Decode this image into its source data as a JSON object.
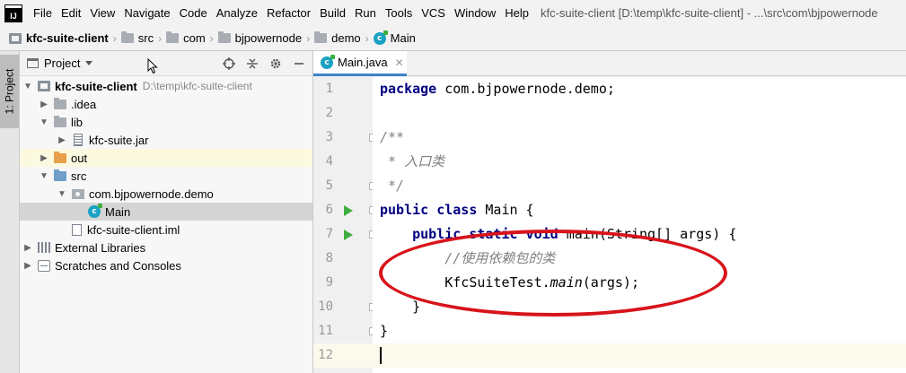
{
  "menubar": {
    "logo": "IJ",
    "items": [
      "File",
      "Edit",
      "View",
      "Navigate",
      "Code",
      "Analyze",
      "Refactor",
      "Build",
      "Run",
      "Tools",
      "VCS",
      "Window",
      "Help"
    ],
    "window_title": "kfc-suite-client [D:\\temp\\kfc-suite-client] - ...\\src\\com\\bjpowernode"
  },
  "breadcrumb": {
    "items": [
      "kfc-suite-client",
      "src",
      "com",
      "bjpowernode",
      "demo",
      "Main"
    ],
    "separator": "›"
  },
  "tool_strip": {
    "project_tab": "1: Project"
  },
  "project_panel": {
    "title": "Project",
    "tree": [
      {
        "label": "kfc-suite-client",
        "hint": "D:\\temp\\kfc-suite-client"
      },
      {
        "label": ".idea"
      },
      {
        "label": "lib"
      },
      {
        "label": "kfc-suite.jar"
      },
      {
        "label": "out"
      },
      {
        "label": "src"
      },
      {
        "label": "com.bjpowernode.demo"
      },
      {
        "label": "Main"
      },
      {
        "label": "kfc-suite-client.iml"
      },
      {
        "label": "External Libraries"
      },
      {
        "label": "Scratches and Consoles"
      }
    ]
  },
  "editor": {
    "tab_label": "Main.java",
    "lines": [
      {
        "num": "1",
        "segments": [
          {
            "t": "package",
            "c": "kw"
          },
          {
            "t": " com.bjpowernode.demo;",
            "c": ""
          }
        ]
      },
      {
        "num": "2",
        "segments": []
      },
      {
        "num": "3",
        "segments": [
          {
            "t": "/**",
            "c": "cm"
          }
        ]
      },
      {
        "num": "4",
        "segments": [
          {
            "t": " * 入口类",
            "c": "cm"
          }
        ]
      },
      {
        "num": "5",
        "segments": [
          {
            "t": " */",
            "c": "cm"
          }
        ]
      },
      {
        "num": "6",
        "segments": [
          {
            "t": "public class",
            "c": "kw"
          },
          {
            "t": " Main {",
            "c": ""
          }
        ]
      },
      {
        "num": "7",
        "segments": [
          {
            "t": "    ",
            "c": ""
          },
          {
            "t": "public static void",
            "c": "kw"
          },
          {
            "t": " main(String[] args) {",
            "c": ""
          }
        ]
      },
      {
        "num": "8",
        "segments": [
          {
            "t": "        //使用依赖包的类",
            "c": "cm"
          }
        ]
      },
      {
        "num": "9",
        "segments": [
          {
            "t": "        KfcSuiteTest.",
            "c": ""
          },
          {
            "t": "main",
            "c": "it"
          },
          {
            "t": "(args);",
            "c": ""
          }
        ]
      },
      {
        "num": "10",
        "segments": [
          {
            "t": "    }",
            "c": ""
          }
        ]
      },
      {
        "num": "11",
        "segments": [
          {
            "t": "}",
            "c": ""
          }
        ]
      },
      {
        "num": "12",
        "segments": []
      }
    ]
  },
  "colors": {
    "accent": "#4083c9",
    "annotation": "#d8131b",
    "run": "#3fae3f",
    "keyword": "#000080",
    "comment": "#808080"
  }
}
